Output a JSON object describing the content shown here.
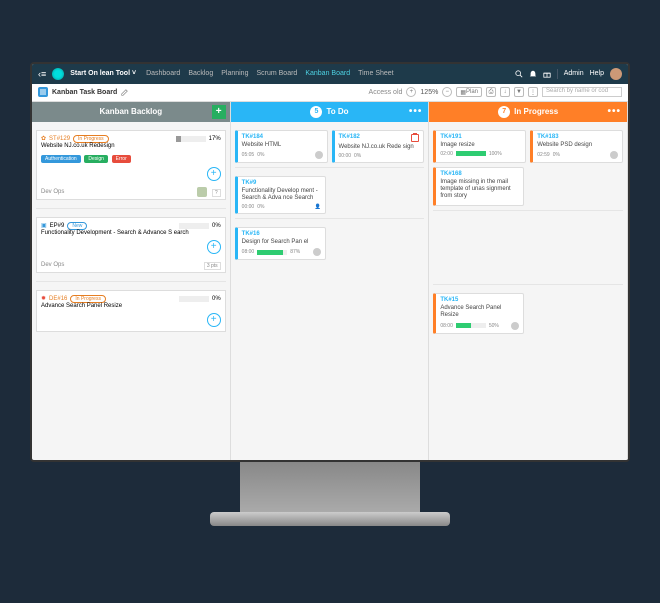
{
  "header": {
    "project": "Start On lean Tool",
    "nav": [
      "Dashboard",
      "Backlog",
      "Planning",
      "Scrum Board",
      "Kanban Board",
      "Time Sheet"
    ],
    "activeNav": "Kanban Board",
    "admin": "Admin",
    "help": "Help"
  },
  "toolbar": {
    "boardName": "Kanban Task Board",
    "access": "Access old",
    "zoom": "125%",
    "plan": "Plan",
    "searchPlaceholder": "Search by name or cod"
  },
  "columns": {
    "backlog": {
      "label": "Kanban Backlog"
    },
    "todo": {
      "count": "5",
      "label": "To Do"
    },
    "progress": {
      "count": "7",
      "label": "In Progress"
    }
  },
  "swim1": {
    "story": {
      "id": "ST#129",
      "status": "In Progress",
      "pctLabel": "17%",
      "title": "Website NJ.co.uk Redesign",
      "tags": [
        "Authentication",
        "Design",
        "Error"
      ],
      "group": "Dev Ops",
      "pts": "?"
    },
    "todo1": {
      "id": "TK#184",
      "title": "Website HTML",
      "time": "05:05",
      "pct": "0%"
    },
    "todo2": {
      "id": "TK#182",
      "title": "Website NJ.co.uk Rede sign",
      "time": "00:00",
      "pct": "0%",
      "pctText": "0%",
      "hasCal": true
    },
    "prog1": {
      "id": "TK#191",
      "title": "Image resize",
      "time": "02:00",
      "pct": "100%",
      "fill": 100
    },
    "prog2": {
      "id": "TK#183",
      "title": "Website PSD design",
      "time": "02:59",
      "pct": "0%"
    },
    "prog3": {
      "id": "TK#168",
      "title": "Image missing in the mail template of unas signment from story"
    }
  },
  "swim2": {
    "story": {
      "id": "EP#9",
      "status": "New",
      "pctLabel": "0%",
      "title": "Functionality Development - Search & Advance S earch",
      "group": "Dev Ops",
      "pts": "3 pts"
    },
    "todo1": {
      "id": "TK#9",
      "title": "Functionality Develop ment - Search & Adva nce Search",
      "time": "00:00",
      "pct": "0%"
    }
  },
  "swim3": {
    "story": {
      "id": "DE#16",
      "status": "In Progress",
      "pctLabel": "0%",
      "title": "Advance Search Panel Resize"
    },
    "todo1": {
      "id": "TK#16",
      "title": "Design for Search Pan el",
      "time": "08:00",
      "pct": "87%",
      "fill": 87
    },
    "prog1": {
      "id": "TK#15",
      "title": "Advance Search Panel Resize",
      "time": "08:00",
      "pct": "50%",
      "fill": 50
    }
  }
}
